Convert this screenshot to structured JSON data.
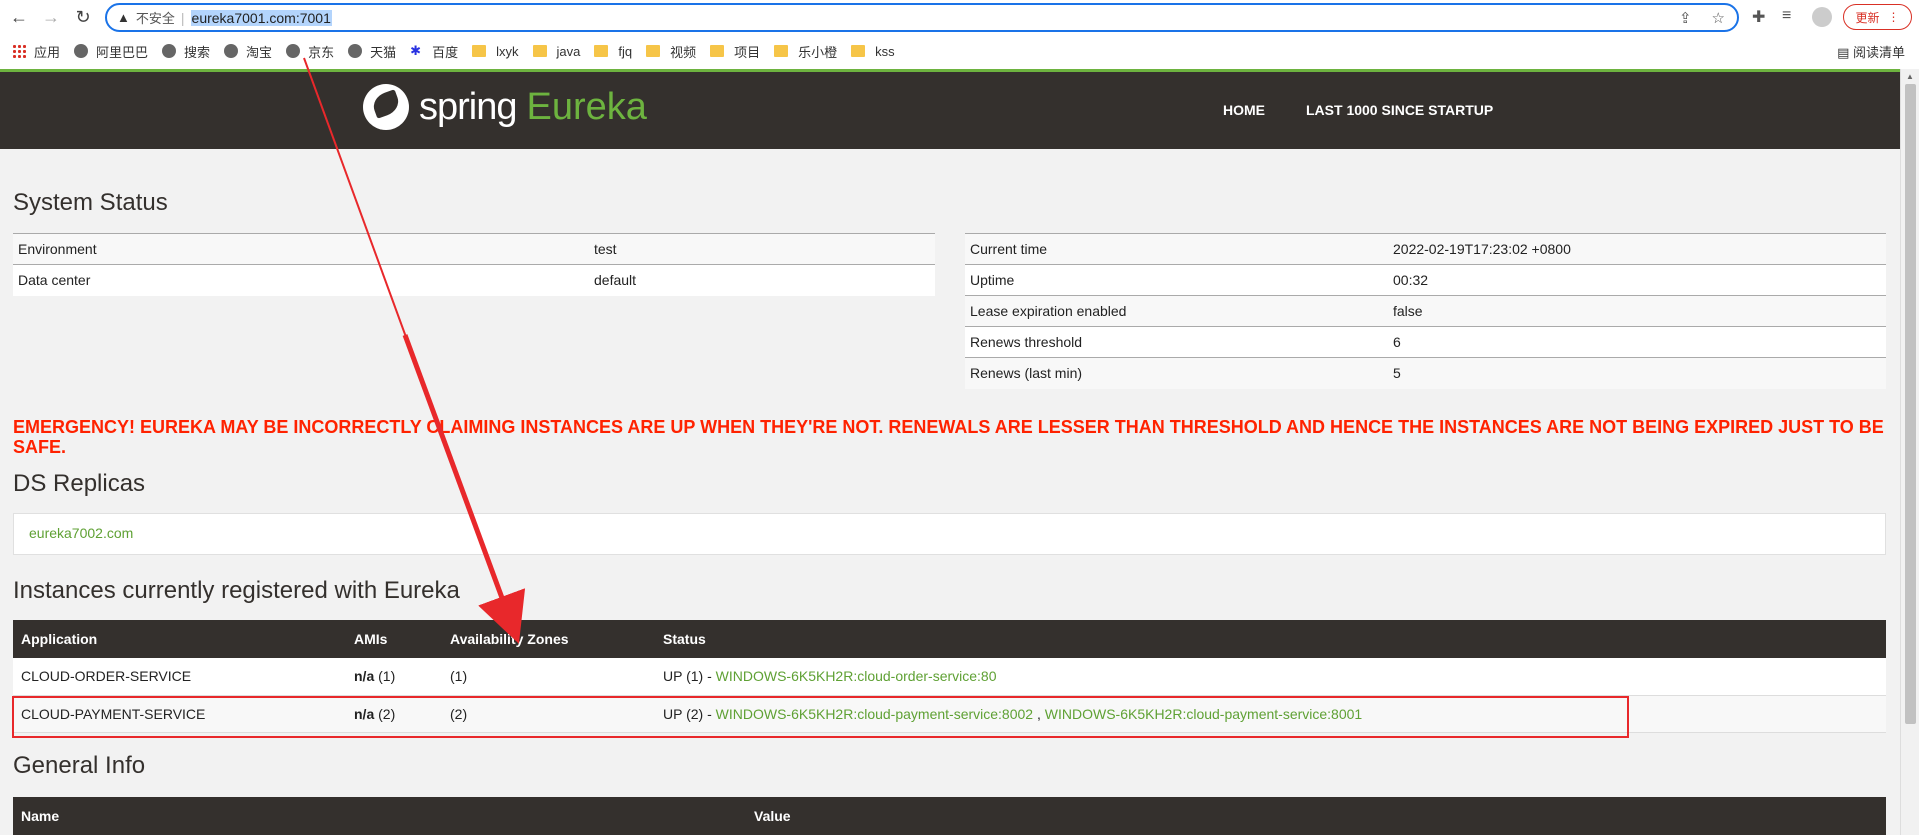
{
  "browser": {
    "security_label": "不安全",
    "url": "eureka7001.com:7001",
    "update_label": "更新",
    "read_list": "阅读清单",
    "bookmarks": [
      {
        "label": "应用",
        "icon": "apps-grid-icon"
      },
      {
        "label": "阿里巴巴",
        "icon": "globe-icon"
      },
      {
        "label": "搜索",
        "icon": "globe-icon"
      },
      {
        "label": "淘宝",
        "icon": "globe-icon"
      },
      {
        "label": "京东",
        "icon": "globe-icon"
      },
      {
        "label": "天猫",
        "icon": "globe-icon"
      },
      {
        "label": "百度",
        "icon": "baidu-paw-icon"
      },
      {
        "label": "lxyk",
        "icon": "folder-icon"
      },
      {
        "label": "java",
        "icon": "folder-icon"
      },
      {
        "label": "fjq",
        "icon": "folder-icon"
      },
      {
        "label": "视频",
        "icon": "folder-icon"
      },
      {
        "label": "项目",
        "icon": "folder-icon"
      },
      {
        "label": "乐小橙",
        "icon": "folder-icon"
      },
      {
        "label": "kss",
        "icon": "folder-icon"
      }
    ]
  },
  "header": {
    "brand": "spring",
    "product": "Eureka",
    "nav": {
      "home": "HOME",
      "last1000": "LAST 1000 SINCE STARTUP"
    }
  },
  "system_status": {
    "title": "System Status",
    "left": [
      {
        "k": "Environment",
        "v": "test"
      },
      {
        "k": "Data center",
        "v": "default"
      }
    ],
    "right": [
      {
        "k": "Current time",
        "v": "2022-02-19T17:23:02 +0800"
      },
      {
        "k": "Uptime",
        "v": "00:32"
      },
      {
        "k": "Lease expiration enabled",
        "v": "false"
      },
      {
        "k": "Renews threshold",
        "v": "6"
      },
      {
        "k": "Renews (last min)",
        "v": "5"
      }
    ]
  },
  "emergency": "EMERGENCY! EUREKA MAY BE INCORRECTLY CLAIMING INSTANCES ARE UP WHEN THEY'RE NOT. RENEWALS ARE LESSER THAN THRESHOLD AND HENCE THE INSTANCES ARE NOT BEING EXPIRED JUST TO BE SAFE.",
  "replicas": {
    "title": "DS Replicas",
    "items": [
      "eureka7002.com"
    ]
  },
  "instances": {
    "title": "Instances currently registered with Eureka",
    "headers": [
      "Application",
      "AMIs",
      "Availability Zones",
      "Status"
    ],
    "rows": [
      {
        "app": "CLOUD-ORDER-SERVICE",
        "amis_bold": "n/a",
        "amis_count": "(1)",
        "zones": "(1)",
        "status_prefix": "UP (1) - ",
        "links": [
          "WINDOWS-6K5KH2R:cloud-order-service:80"
        ]
      },
      {
        "app": "CLOUD-PAYMENT-SERVICE",
        "amis_bold": "n/a",
        "amis_count": "(2)",
        "zones": "(2)",
        "status_prefix": "UP (2) - ",
        "links": [
          "WINDOWS-6K5KH2R:cloud-payment-service:8002",
          "WINDOWS-6K5KH2R:cloud-payment-service:8001"
        ],
        "link_sep": " , "
      }
    ]
  },
  "general": {
    "title": "General Info",
    "headers": [
      "Name",
      "Value"
    ]
  },
  "colors": {
    "brand_green": "#6db33f",
    "header_bg": "#34302d",
    "emergency_red": "#ff2200",
    "annotation_red": "#e8282b"
  }
}
